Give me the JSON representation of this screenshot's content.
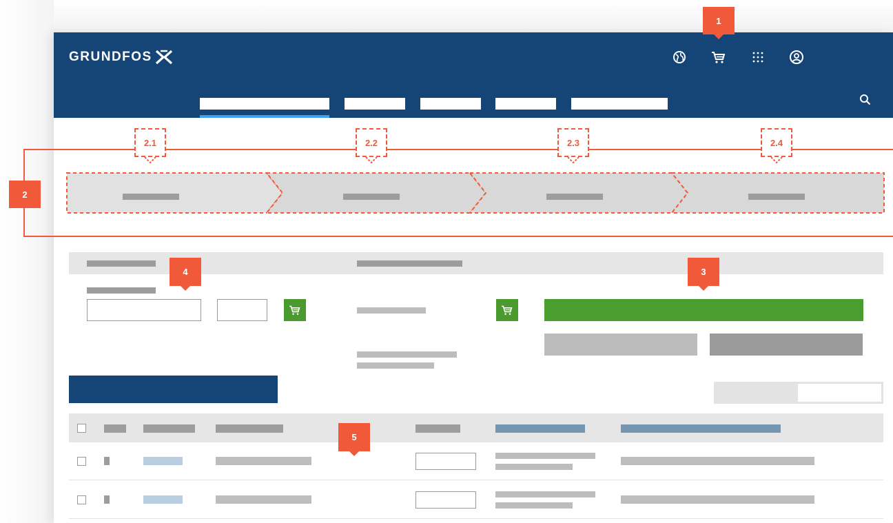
{
  "header": {
    "logo_text": "GRUNDFOS",
    "icons": [
      "globe-icon",
      "cart-icon",
      "apps-grid-icon",
      "user-icon",
      "search-icon"
    ]
  },
  "callouts": {
    "c1": "1",
    "c2": "2",
    "c2_1": "2.1",
    "c2_2": "2.2",
    "c2_3": "2.3",
    "c2_4": "2.4",
    "c3": "3",
    "c4": "4",
    "c5": "5"
  },
  "colors": {
    "header_bg": "#154476",
    "nav_active": "#3ea0ef",
    "callout": "#f05a3b",
    "primary_green": "#4a9a2e",
    "primary_blue": "#154476",
    "link_placeholder": "#b8cde0",
    "header_link_placeholder": "#7695b1"
  },
  "table": {
    "row_count": 2
  }
}
